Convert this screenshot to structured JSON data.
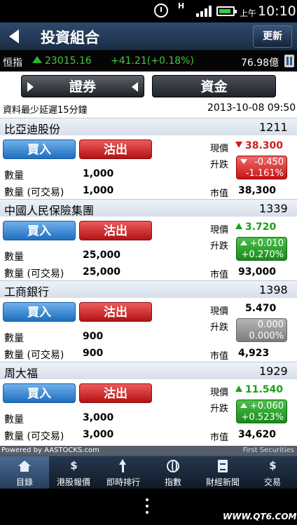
{
  "status": {
    "network": "H",
    "ampm": "上午",
    "time": "10:10"
  },
  "header": {
    "title": "投資組合",
    "refresh_label": "更新"
  },
  "ticker": {
    "name": "恒指",
    "level": "23015.16",
    "change": "+41.21(+0.18%)",
    "turnover": "76.98億"
  },
  "segments": {
    "securities": "證券",
    "funds": "資金"
  },
  "delay_note": "資料最少延遲15分鐘",
  "timestamp": "2013-10-08 09:50",
  "labels": {
    "buy": "買入",
    "sell": "沽出",
    "qty": "數量",
    "qty_tradable": "數量 (可交易)",
    "price": "現價",
    "change": "升跌",
    "market_value": "市值"
  },
  "stocks": [
    {
      "name": "比亞迪股份",
      "code": "1211",
      "qty": "1,000",
      "qty_tradable": "1,000",
      "price": "38.300",
      "direction": "down",
      "change": "-0.450",
      "change_pct": "-1.161%",
      "market_value": "38,300"
    },
    {
      "name": "中國人民保險集團",
      "code": "1339",
      "qty": "25,000",
      "qty_tradable": "25,000",
      "price": "3.720",
      "direction": "up",
      "change": "+0.010",
      "change_pct": "+0.270%",
      "market_value": "93,000"
    },
    {
      "name": "工商銀行",
      "code": "1398",
      "qty": "900",
      "qty_tradable": "900",
      "price": "5.470",
      "direction": "flat",
      "change": "0.000",
      "change_pct": "0.000%",
      "market_value": "4,923"
    },
    {
      "name": "周大福",
      "code": "1929",
      "qty": "3,000",
      "qty_tradable": "3,000",
      "price": "11.540",
      "direction": "up",
      "change": "+0.060",
      "change_pct": "+0.523%",
      "market_value": "34,620"
    }
  ],
  "footer": {
    "powered_by": "Powered by AASTOCKS.com",
    "partner": "First Securities"
  },
  "tabs": [
    {
      "label": "目錄",
      "icon": "home-icon"
    },
    {
      "label": "港股報價",
      "icon": "dollar-icon",
      "glyph": "$"
    },
    {
      "label": "即時排行",
      "icon": "sort-icon"
    },
    {
      "label": "指數",
      "icon": "globe-icon"
    },
    {
      "label": "財經新聞",
      "icon": "news-icon"
    },
    {
      "label": "交易",
      "icon": "dollar-icon",
      "glyph": "$"
    }
  ],
  "watermark": "WWW.QT6.COM",
  "colors": {
    "up": "#1aa01a",
    "down": "#d21a1a",
    "buy": "#1f6ec0",
    "sell": "#b31313",
    "header": "#1a2d46"
  }
}
